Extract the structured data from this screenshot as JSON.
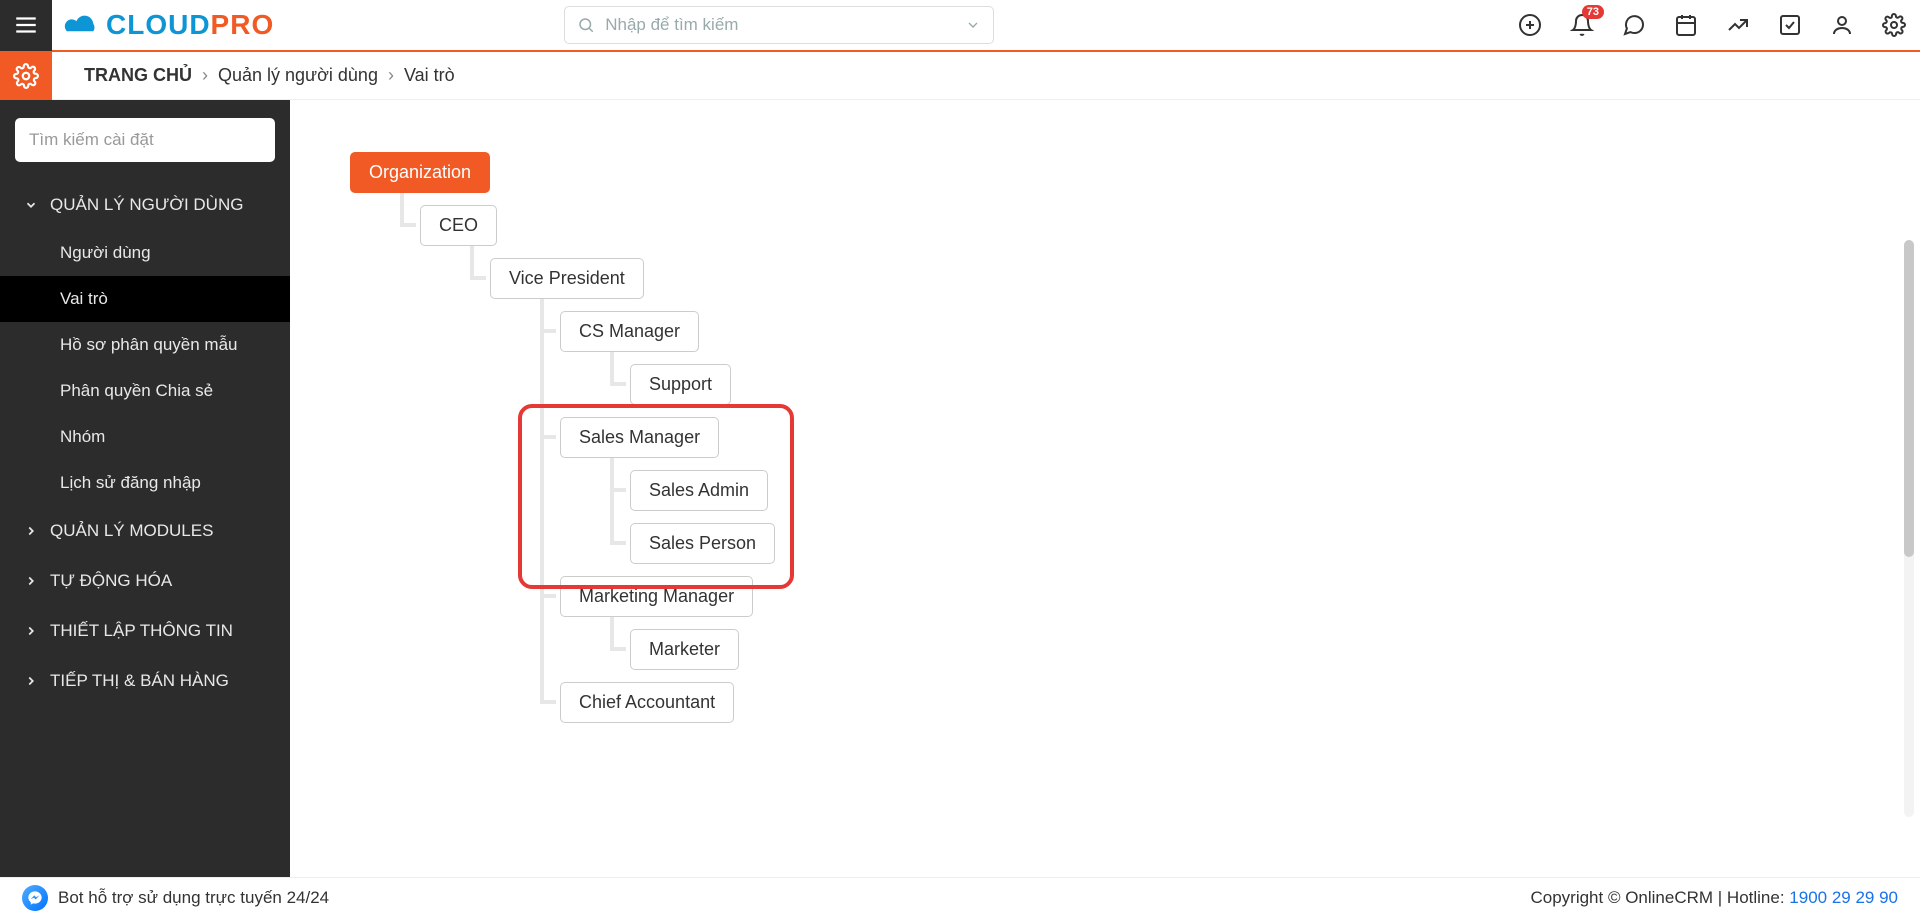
{
  "header": {
    "logo_cloud": "CLOUD",
    "logo_pro": "PRO",
    "search_placeholder": "Nhập để tìm kiếm",
    "notification_count": "73"
  },
  "breadcrumb": {
    "home": "TRANG CHỦ",
    "level1": "Quản lý người dùng",
    "level2": "Vai trò"
  },
  "sidebar": {
    "search_placeholder": "Tìm kiếm cài đặt",
    "cat_user": "QUẢN LÝ NGƯỜI DÙNG",
    "sub_users": "Người dùng",
    "sub_roles": "Vai trò",
    "sub_profiles": "Hồ sơ phân quyền mẫu",
    "sub_sharing": "Phân quyền Chia sẻ",
    "sub_groups": "Nhóm",
    "sub_loginhist": "Lịch sử đăng nhập",
    "cat_modules": "QUẢN LÝ MODULES",
    "cat_automation": "TỰ ĐỘNG HÓA",
    "cat_config": "THIẾT LẬP THÔNG TIN",
    "cat_marketing": "TIẾP THỊ & BÁN HÀNG"
  },
  "tree": {
    "root": "Organization",
    "ceo": "CEO",
    "vp": "Vice President",
    "cs_manager": "CS Manager",
    "support": "Support",
    "sales_manager": "Sales Manager",
    "sales_admin": "Sales Admin",
    "sales_person": "Sales Person",
    "mkt_manager": "Marketing Manager",
    "marketer": "Marketer",
    "chief_acc": "Chief Accountant"
  },
  "footer": {
    "bot": "Bot hỗ trợ sử dụng trực tuyến 24/24",
    "copyright": "Copyright © OnlineCRM | Hotline: ",
    "hotline": "1900 29 29 90"
  }
}
